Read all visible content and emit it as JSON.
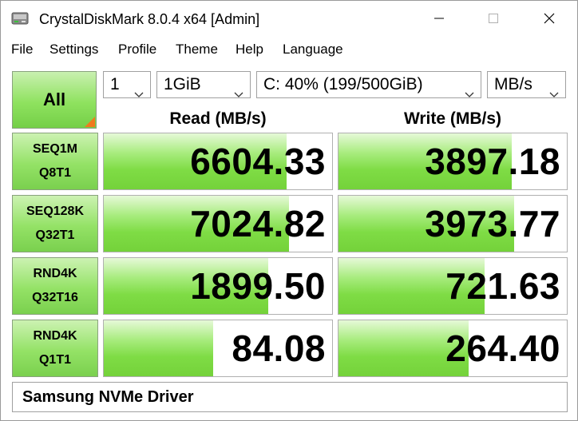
{
  "window": {
    "title": "CrystalDiskMark 8.0.4 x64 [Admin]",
    "icons": {
      "app": "disk-app-icon",
      "minimize": "minimize-icon",
      "maximize": "maximize-icon",
      "close": "close-icon"
    }
  },
  "menu": {
    "items": [
      "File",
      "Settings",
      "Profile",
      "Theme",
      "Help",
      "Language"
    ]
  },
  "toolbar": {
    "all_label": "All",
    "count": "1",
    "size": "1GiB",
    "drive": "C: 40% (199/500GiB)",
    "unit": "MB/s"
  },
  "headers": {
    "read": "Read (MB/s)",
    "write": "Write (MB/s)"
  },
  "results": [
    {
      "line1": "SEQ1M",
      "line2": "Q8T1",
      "read": "6604.33",
      "write": "3897.18",
      "read_fill": 0.8,
      "write_fill": 0.76
    },
    {
      "line1": "SEQ128K",
      "line2": "Q32T1",
      "read": "7024.82",
      "write": "3973.77",
      "read_fill": 0.81,
      "write_fill": 0.77
    },
    {
      "line1": "RND4K",
      "line2": "Q32T16",
      "read": "1899.50",
      "write": "721.63",
      "read_fill": 0.72,
      "write_fill": 0.64
    },
    {
      "line1": "RND4K",
      "line2": "Q1T1",
      "read": "84.08",
      "write": "264.40",
      "read_fill": 0.48,
      "write_fill": 0.57
    }
  ],
  "comment": "Samsung NVMe Driver",
  "colors": {
    "bar_green": "#7fdc45",
    "button_green": "#94e266",
    "corner_orange": "#f07a1e"
  }
}
